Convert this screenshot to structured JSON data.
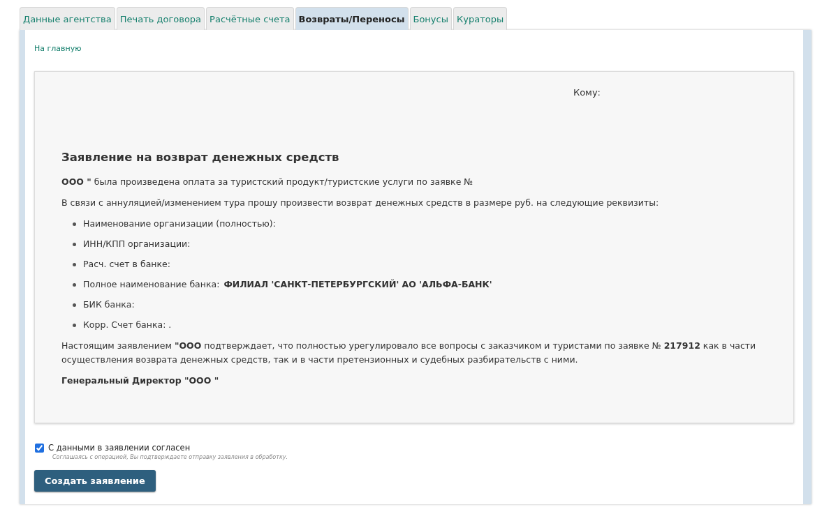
{
  "tabs": [
    {
      "label": "Данные агентства",
      "selected": false
    },
    {
      "label": "Печать договора",
      "selected": false
    },
    {
      "label": "Расчётные счета",
      "selected": false
    },
    {
      "label": "Возвраты/Переносы",
      "selected": true
    },
    {
      "label": "Бонусы",
      "selected": false
    },
    {
      "label": "Кураторы",
      "selected": false
    }
  ],
  "home_link": "На главную",
  "statement": {
    "to_label": "Кому:",
    "title": "Заявление на возврат денежных средств",
    "paragraphs": [
      "**ООО \"** была произведена оплата за туристский продукт/туристские услуги по заявке №",
      "В связи с аннуляцией/изменением тура прошу произвести возврат денежных средств в размере руб. на следующие реквизиты:"
    ],
    "requisites": [
      {
        "label": "Наименование организации (полностью):"
      },
      {
        "label": "ИНН/КПП организации:"
      },
      {
        "label": "Расч. счет в банке:"
      },
      {
        "label": "Полное наименование банка:",
        "value": "ФИЛИАЛ 'САНКТ-ПЕТЕРБУРГСКИЙ' АО 'АЛЬФА-БАНК'"
      },
      {
        "label": "БИК банка:"
      },
      {
        "label": "Корр. Счет банка: ."
      }
    ],
    "confirmation": "Настоящим заявлением **\"ООО** подтверждает, что полностью урегулировало все вопросы с заказчиком и туристами по заявке № **217912** как в части осуществления возврата денежных средств, так и в части претензионных и судебных разбирательств с ними.",
    "signature": "Генеральный Директор \"ООО \""
  },
  "agreement": {
    "label": "С данными в заявлении согласен",
    "checked": true,
    "hint": "Соглашаясь с операцией, Вы подтверждаете отправку заявления в обработку."
  },
  "submit_button": "Создать заявление"
}
